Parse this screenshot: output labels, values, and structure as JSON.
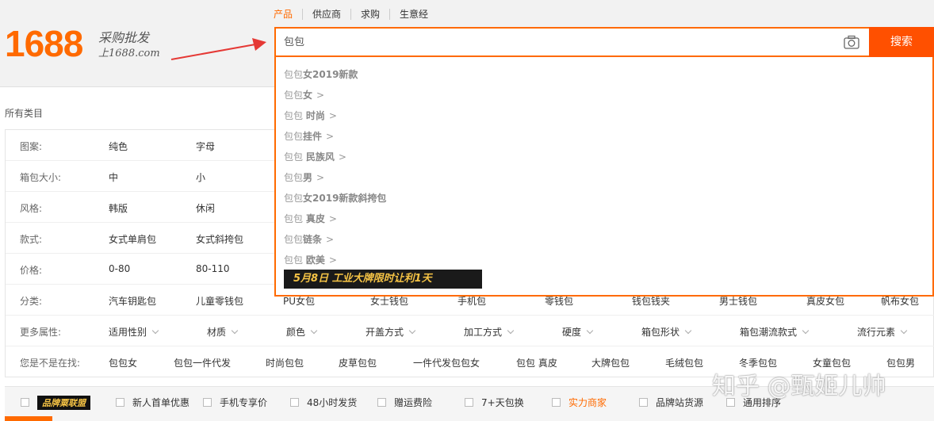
{
  "logo": {
    "number": "1688",
    "slogan_line1": "采购批发",
    "slogan_line2": "上1688.com"
  },
  "tabs": [
    {
      "label": "产品",
      "active": true
    },
    {
      "label": "供应商",
      "active": false
    },
    {
      "label": "求购",
      "active": false
    },
    {
      "label": "生意经",
      "active": false
    }
  ],
  "search": {
    "value": "包包",
    "button_label": "搜索",
    "accent": "#ff6a00"
  },
  "suggestions": [
    {
      "prefix": "包包",
      "bold": "女2019新款",
      "arrow": ""
    },
    {
      "prefix": "包包",
      "bold": "女",
      "arrow": ">"
    },
    {
      "prefix": "包包 ",
      "bold": "时尚",
      "arrow": ">"
    },
    {
      "prefix": "包包",
      "bold": "挂件",
      "arrow": ">"
    },
    {
      "prefix": "包包 ",
      "bold": "民族风",
      "arrow": ">"
    },
    {
      "prefix": "包包",
      "bold": "男",
      "arrow": ">"
    },
    {
      "prefix": "包包",
      "bold": "女2019新款斜挎包",
      "arrow": ""
    },
    {
      "prefix": "包包 ",
      "bold": "真皮",
      "arrow": ">"
    },
    {
      "prefix": "包包",
      "bold": "链条",
      "arrow": ">"
    },
    {
      "prefix": "包包 ",
      "bold": "欧美",
      "arrow": ">"
    }
  ],
  "banner": {
    "text": "5月8日  工业大牌限时让利1天"
  },
  "all_categories": "所有类目",
  "filters": [
    {
      "label": "图案:",
      "values": [
        "纯色",
        "字母"
      ]
    },
    {
      "label": "箱包大小:",
      "values": [
        "中",
        "小"
      ]
    },
    {
      "label": "风格:",
      "values": [
        "韩版",
        "休闲"
      ]
    },
    {
      "label": "款式:",
      "values": [
        "女式单肩包",
        "女式斜挎包"
      ]
    },
    {
      "label": "价格:",
      "values": [
        "0-80",
        "80-110"
      ]
    },
    {
      "label": "分类:",
      "values": [
        "汽车钥匙包",
        "儿童零钱包",
        "PU女包",
        "女士钱包",
        "手机包",
        "零钱包",
        "钱包钱夹",
        "男士钱包",
        "真皮女包",
        "帆布女包"
      ]
    },
    {
      "label": "更多属性:",
      "values": [
        "适用性别",
        "材质",
        "颜色",
        "开盖方式",
        "加工方式",
        "硬度",
        "箱包形状",
        "箱包潮流款式",
        "流行元素"
      ]
    },
    {
      "label": "您是不是在找:",
      "values": [
        "包包女",
        "包包一件代发",
        "时尚包包",
        "皮草包包",
        "一件代发包包女",
        "包包 真皮",
        "大牌包包",
        "毛绒包包",
        "冬季包包",
        "女童包包",
        "包包男"
      ]
    }
  ],
  "bottom_options": [
    {
      "label": "品牌粟联盟",
      "badge": true
    },
    {
      "label": "新人首单优惠"
    },
    {
      "label": "手机专享价"
    },
    {
      "label": "48小时发货"
    },
    {
      "label": "赠运费险"
    },
    {
      "label": "7+天包换"
    },
    {
      "label": "实力商家",
      "hot": true
    },
    {
      "label": "品牌站货源"
    },
    {
      "label": "通用排序"
    }
  ],
  "watermark": "知乎 @甄姬儿帅"
}
